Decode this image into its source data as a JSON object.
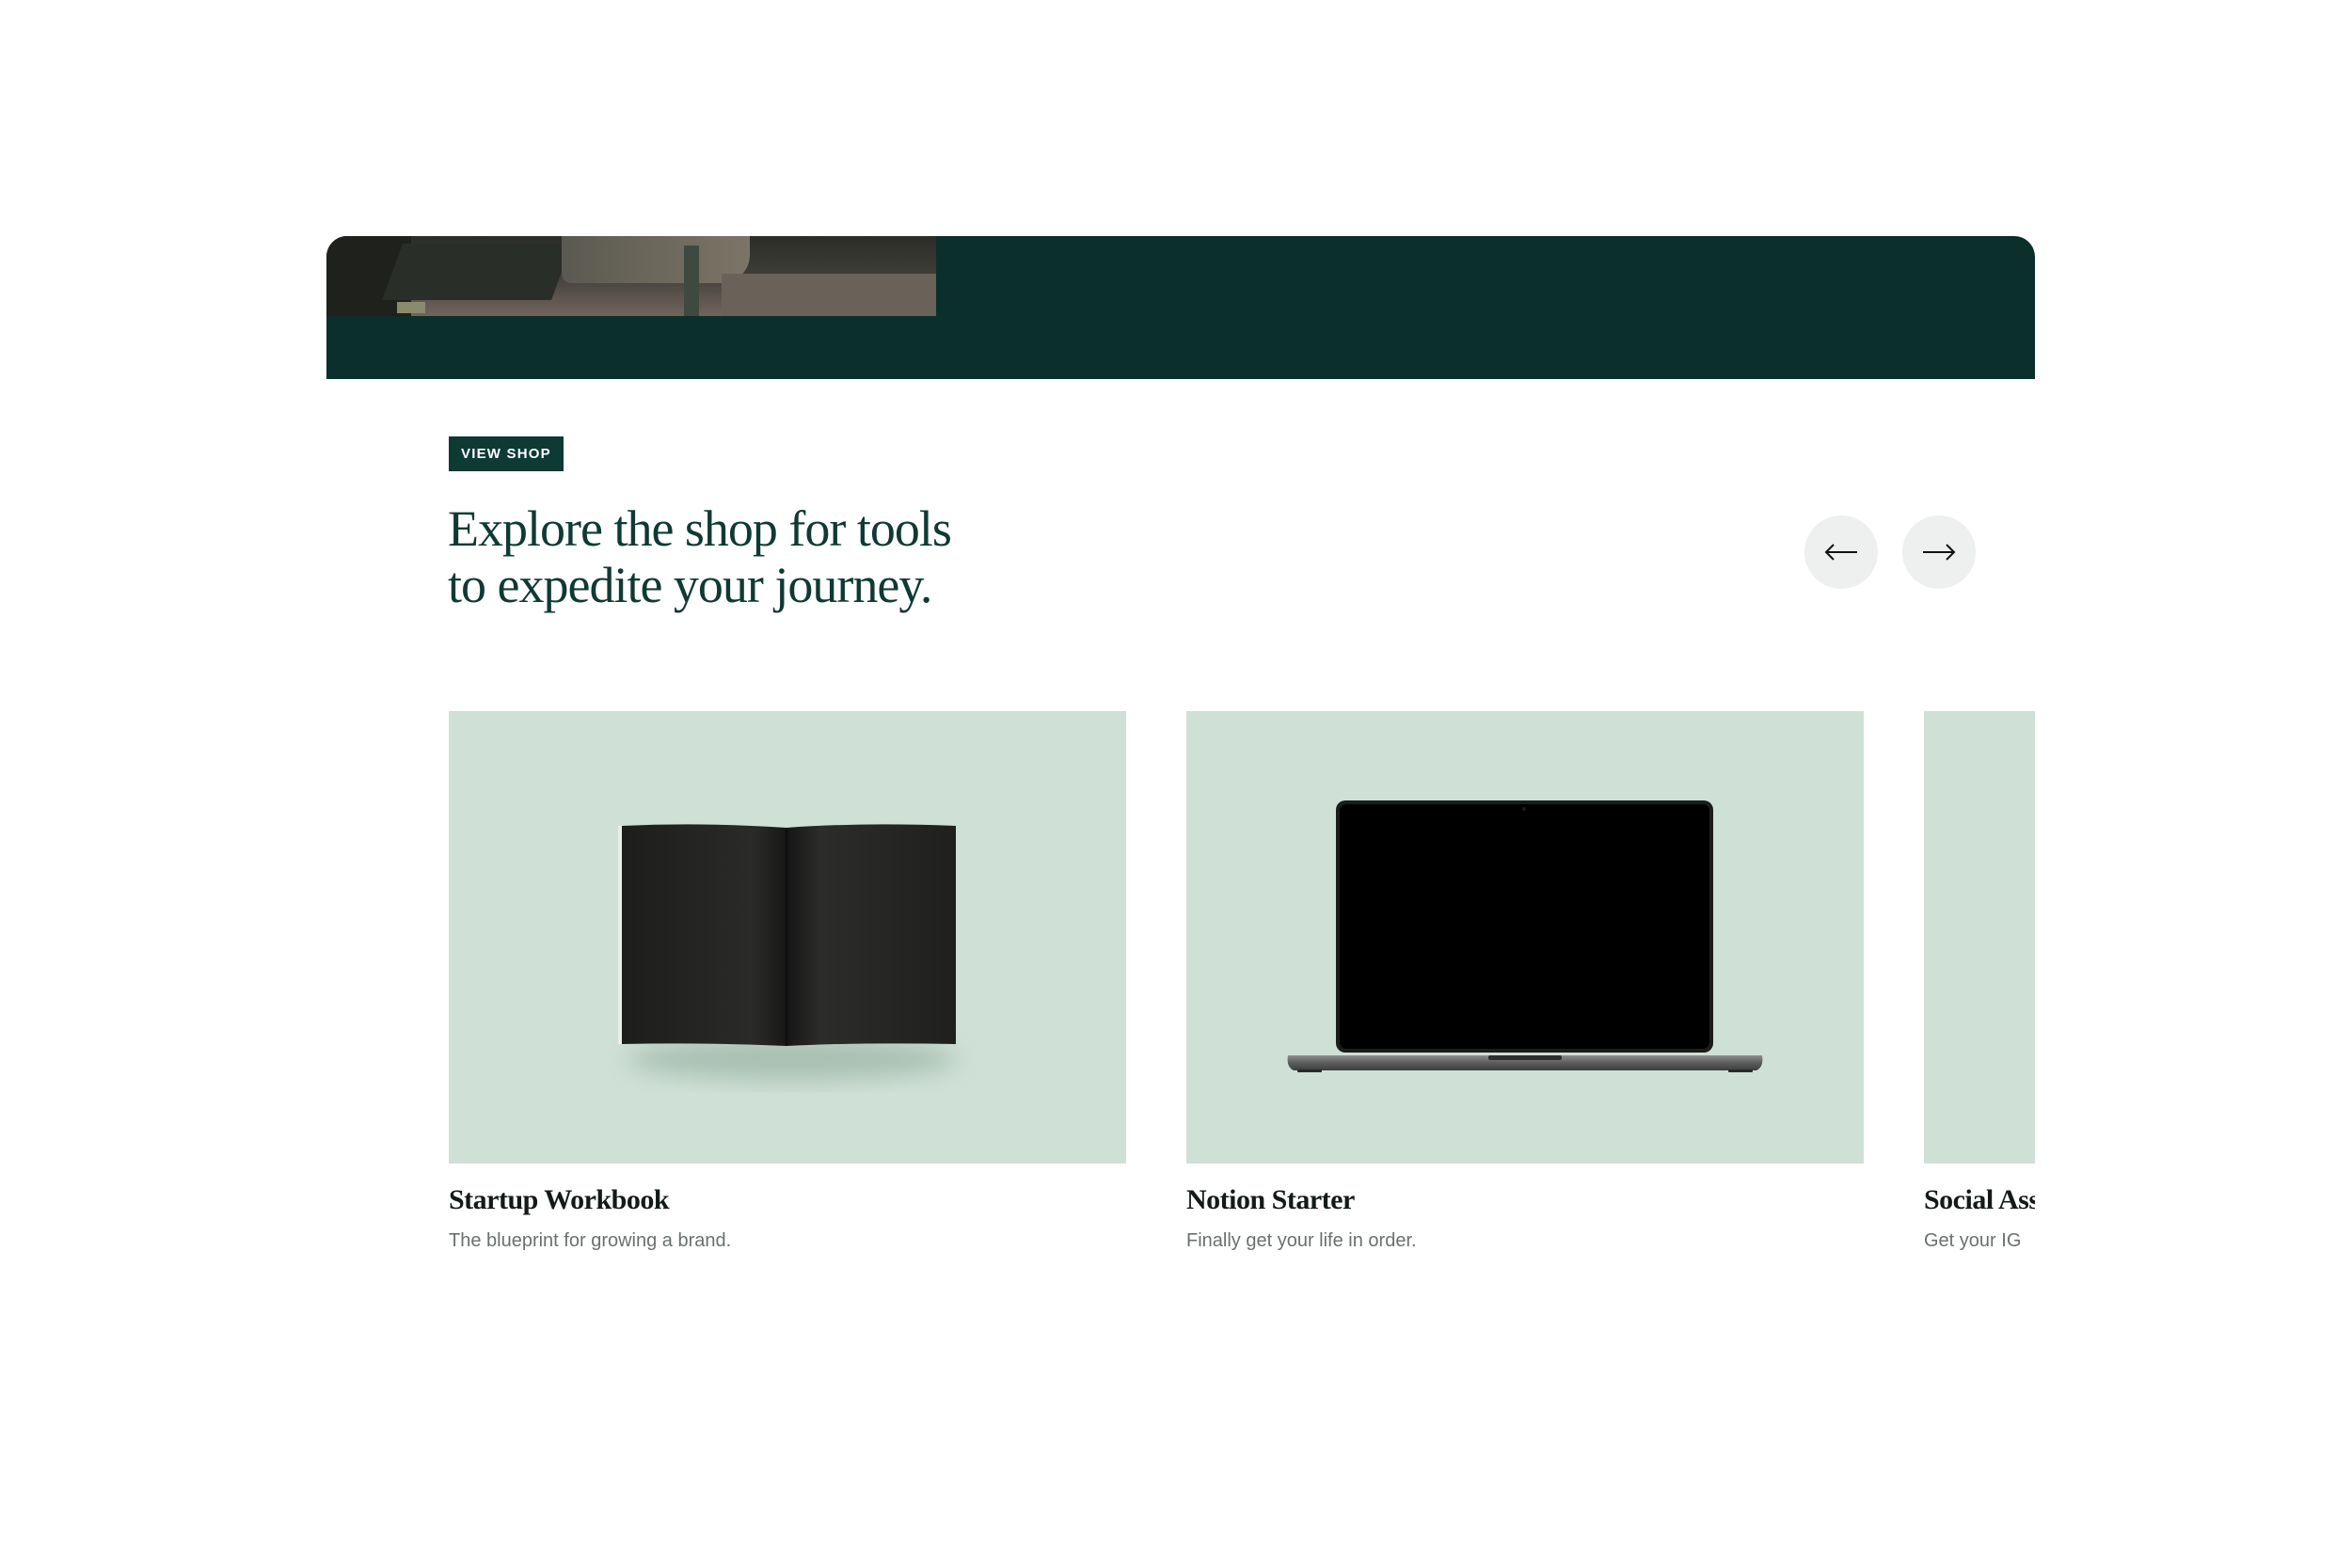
{
  "section": {
    "badge_label": "VIEW SHOP",
    "headline_line1": "Explore the shop for tools",
    "headline_line2": "to expedite your journey."
  },
  "carousel": {
    "prev_icon": "arrow-left-icon",
    "next_icon": "arrow-right-icon",
    "products": [
      {
        "title": "Startup Workbook",
        "description": "The blueprint for growing a brand.",
        "image": "open-book-image"
      },
      {
        "title": "Notion Starter",
        "description": "Finally get your life in order.",
        "image": "laptop-image"
      },
      {
        "title": "Social Ass",
        "description": "Get your IG",
        "image": "product-image"
      }
    ]
  },
  "colors": {
    "brand_dark_green": "#0b302b",
    "badge_bg": "#0e3a34",
    "card_bg": "#cfe0d6",
    "nav_button_bg": "#edf0ee",
    "headline_text": "#0f3a33"
  }
}
